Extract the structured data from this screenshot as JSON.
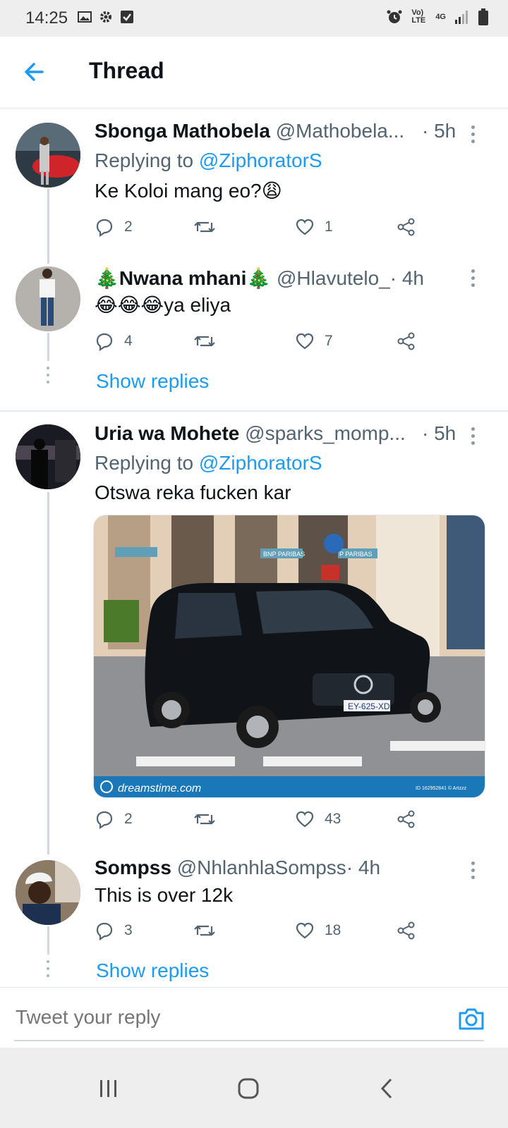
{
  "status_bar": {
    "time": "14:25",
    "network": "4G",
    "volte": "Vo) LTE"
  },
  "header": {
    "title": "Thread"
  },
  "tweets": [
    {
      "name": "Sbonga Mathobela",
      "handle": "@Mathobela...",
      "time": "· 5h",
      "replying_label": "Replying to",
      "replying_to": "@ZiphoratorS",
      "text": "Ke Koloi mang eo?😩",
      "replies": "2",
      "retweets": "",
      "likes": "1"
    },
    {
      "name": "🎄Nwana mhani🎄",
      "handle": "@Hlavutelo_",
      "time": "· 4h",
      "text": "😂😂😂ya eliya",
      "replies": "4",
      "retweets": "",
      "likes": "7",
      "show_replies": "Show replies"
    },
    {
      "name": "Uria wa Mohete",
      "handle": "@sparks_momp...",
      "time": "· 5h",
      "replying_label": "Replying to",
      "replying_to": "@ZiphoratorS",
      "text": "Otswa reka fucken kar",
      "media": {
        "watermark": "dreamstime.com",
        "id_text": "ID 162952841 © Artzzz",
        "plate": "EY-625-XD",
        "sign1": "BNP PARIBAS",
        "sign2": "P PARIBAS"
      },
      "replies": "2",
      "retweets": "",
      "likes": "43"
    },
    {
      "name": "Sompss",
      "handle": "@NhlanhlaSompss",
      "time": "· 4h",
      "text": "This is over 12k",
      "replies": "3",
      "retweets": "",
      "likes": "18",
      "show_replies": "Show replies"
    }
  ],
  "composer": {
    "placeholder": "Tweet your reply"
  },
  "colors": {
    "accent": "#1d9bf0",
    "text": "#0f1419",
    "muted": "#536471"
  }
}
